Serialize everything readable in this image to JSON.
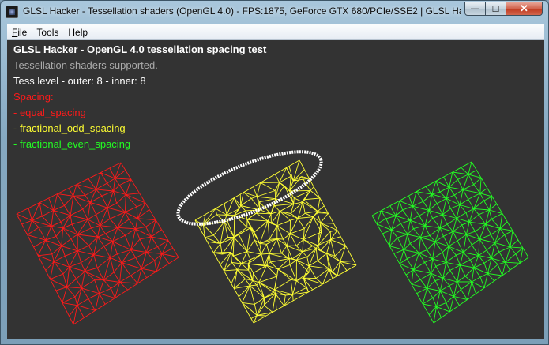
{
  "window": {
    "title": "GLSL Hacker - Tessellation shaders (OpenGL 4.0) - FPS:1875, GeForce GTX 680/PCIe/SSE2 | GLSL Hacke...",
    "buttons": {
      "minimize": "—",
      "maximize": "☐",
      "close": "✕"
    }
  },
  "menu": [
    {
      "prefix": "F",
      "rest": "ile"
    },
    {
      "prefix": "",
      "rest": "Tools"
    },
    {
      "prefix": "",
      "rest": "Help"
    }
  ],
  "hud": {
    "title": "GLSL Hacker - OpenGL 4.0 tessellation spacing test",
    "support": "Tessellation shaders supported.",
    "tess_level": "Tess level - outer: 8 - inner: 8",
    "spacing_header": "Spacing:",
    "equal": "- equal_spacing",
    "odd": "- fractional_odd_spacing",
    "even": "- fractional_even_spacing"
  },
  "colors": {
    "red": "#ff1a1a",
    "yellow": "#ffff33",
    "green": "#22ff22",
    "white": "#ffffff",
    "grey": "#aaaaaa",
    "viewport_bg": "#333333"
  }
}
